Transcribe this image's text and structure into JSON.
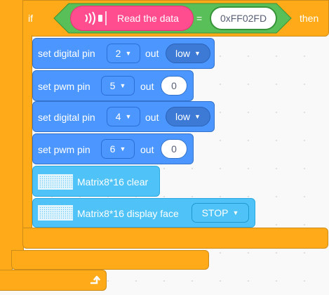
{
  "if_block": {
    "if_label": "if",
    "then_label": "then",
    "sensor_label": "Read the data",
    "operator": "=",
    "compare_value": "0xFF02FD"
  },
  "blocks": [
    {
      "prefix": "set digital pin",
      "pin": "2",
      "mid": "out",
      "value": "low"
    },
    {
      "prefix": "set pwm pin",
      "pin": "5",
      "mid": "out",
      "value": "0"
    },
    {
      "prefix": "set digital pin",
      "pin": "4",
      "mid": "out",
      "value": "low"
    },
    {
      "prefix": "set pwm pin",
      "pin": "6",
      "mid": "out",
      "value": "0"
    }
  ],
  "matrix": {
    "clear_label": "Matrix8*16 clear",
    "face_label": "Matrix8*16 display face",
    "face_value": "STOP"
  },
  "icons": {
    "loop_arrow": "loop-arrow-icon",
    "ir": "ir-receiver-icon",
    "matrix": "led-matrix-icon",
    "dropdown": "caret-down-icon"
  },
  "colors": {
    "control": "#ffab19",
    "operator": "#59c059",
    "sensor": "#ff4d8f",
    "pin": "#4c97ff",
    "matrix": "#4fc3f7"
  }
}
